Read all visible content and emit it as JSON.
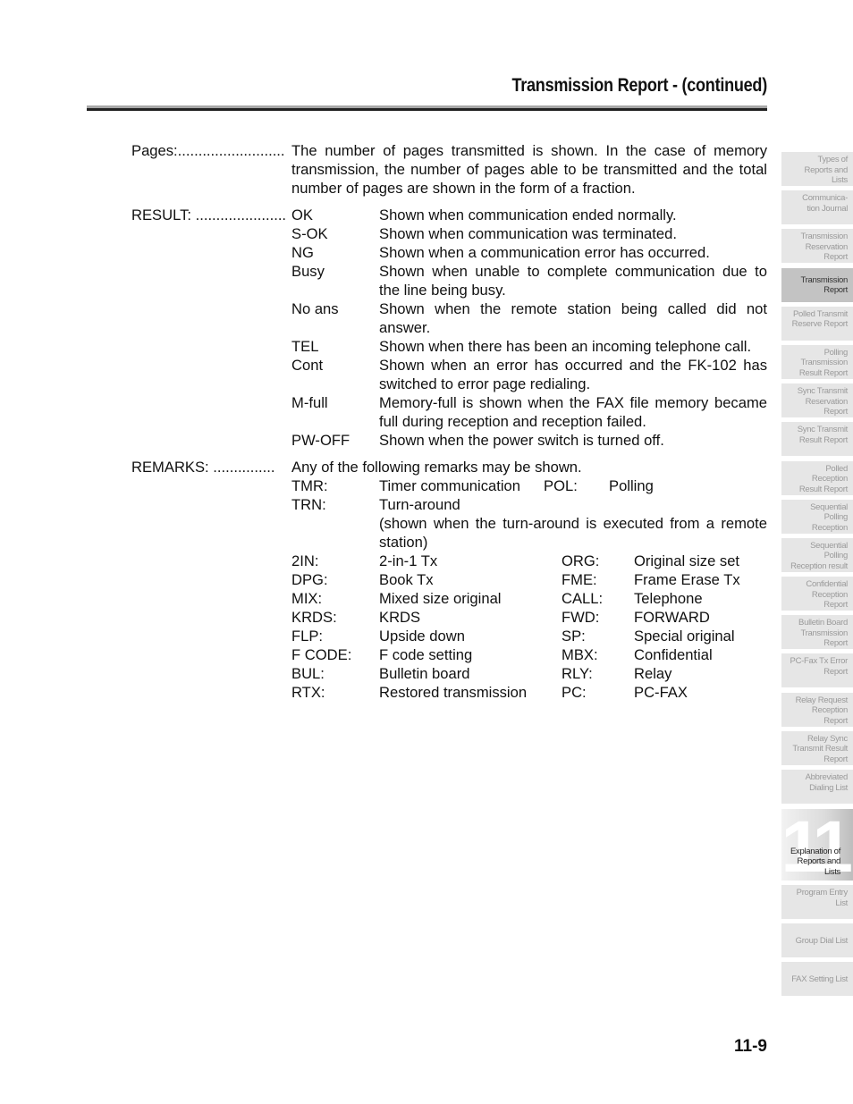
{
  "header": {
    "title": "Transmission Report -  (continued)"
  },
  "pages": {
    "label": "Pages:..........................",
    "text": "The number of pages transmitted is shown. In the case of memory transmission, the number of pages able to be transmitted and the total number of pages are shown in the form of a fraction."
  },
  "result": {
    "label": "RESULT: ......................",
    "items": [
      {
        "code": "OK",
        "desc": "Shown when communication ended normally."
      },
      {
        "code": "S-OK",
        "desc": "Shown when communication was terminated."
      },
      {
        "code": "NG",
        "desc": "Shown when a communication error has occurred."
      },
      {
        "code": "Busy",
        "desc": "Shown when unable to complete communication due to the line being busy."
      },
      {
        "code": "No ans",
        "desc": "Shown when the remote station being called did not answer."
      },
      {
        "code": "TEL",
        "desc": "Shown when there has been an incoming telephone call."
      },
      {
        "code": "Cont",
        "desc": "Shown when an error has occurred and the FK-102 has switched to error page redialing."
      },
      {
        "code": "M-full",
        "desc": "Memory-full is shown when the FAX file memory became full during reception and reception failed."
      },
      {
        "code": "PW-OFF",
        "desc": "Shown when the power switch is turned off."
      }
    ]
  },
  "remarks": {
    "label": "REMARKS:    ...............",
    "intro": "Any of the following remarks may be shown.",
    "tmr": {
      "code": "TMR:",
      "desc": "Timer communication",
      "code2": "POL:",
      "desc2": "Polling"
    },
    "trn": {
      "code": "TRN:",
      "desc": "Turn-around",
      "note": "(shown when the turn-around is executed from a remote station)"
    },
    "pairs": [
      {
        "c1": "2IN:",
        "d1": "2-in-1 Tx",
        "c2": "ORG:",
        "d2": "Original size set"
      },
      {
        "c1": "DPG:",
        "d1": "Book Tx",
        "c2": "FME:",
        "d2": "Frame Erase Tx"
      },
      {
        "c1": "MIX:",
        "d1": "Mixed size original",
        "c2": "CALL:",
        "d2": "Telephone"
      },
      {
        "c1": "KRDS:",
        "d1": "KRDS",
        "c2": "FWD:",
        "d2": "FORWARD"
      },
      {
        "c1": "FLP:",
        "d1": "Upside down",
        "c2": "SP:",
        "d2": "Special original"
      },
      {
        "c1": "F CODE:",
        "d1": "F code setting",
        "c2": "MBX:",
        "d2": "Confidential"
      },
      {
        "c1": "BUL:",
        "d1": "Bulletin board",
        "c2": "RLY:",
        "d2": "Relay"
      },
      {
        "c1": "RTX:",
        "d1": "Restored transmission",
        "c2": "PC:",
        "d2": "PC-FAX"
      }
    ]
  },
  "sidebar": {
    "tabs": [
      {
        "lines": [
          "Types of",
          "Reports and",
          "Lists"
        ]
      },
      {
        "lines": [
          "Communica-",
          "tion Journal"
        ]
      },
      {
        "lines": [
          "Transmission",
          "Reservation",
          "Report"
        ]
      },
      {
        "lines": [
          "Transmission",
          "Report"
        ],
        "active": true
      },
      {
        "lines": [
          "Polled Transmit",
          "Reserve Report"
        ]
      },
      {
        "lines": [
          "Polling",
          "Transmission",
          "Result Report"
        ]
      },
      {
        "lines": [
          "Sync Transmit",
          "Reservation",
          "Report"
        ]
      },
      {
        "lines": [
          "Sync Transmit",
          "Result Report"
        ]
      },
      {
        "lines": [
          "Polled",
          "Reception",
          "Result Report"
        ]
      },
      {
        "lines": [
          "Sequential",
          "Polling",
          "Reception"
        ]
      },
      {
        "lines": [
          "Sequential",
          "Polling",
          "Reception result"
        ]
      },
      {
        "lines": [
          "Confidential",
          "Reception",
          "Report"
        ]
      },
      {
        "lines": [
          "Bulletin Board",
          "Transmission",
          "Report"
        ]
      },
      {
        "lines": [
          "PC-Fax Tx Error",
          "Report"
        ]
      },
      {
        "lines": [
          "Relay Request",
          "Reception",
          "Report"
        ]
      },
      {
        "lines": [
          "Relay Sync",
          "Transmit Result",
          "Report"
        ]
      },
      {
        "lines": [
          "Abbreviated",
          "Dialing List"
        ]
      }
    ],
    "chapter": {
      "number": "11",
      "lines": [
        "Explanation of",
        "Reports and",
        "Lists"
      ]
    },
    "tabs_after": [
      {
        "lines": [
          "Program Entry",
          "List"
        ]
      },
      {
        "lines": [
          "Group Dial List"
        ]
      },
      {
        "lines": [
          "FAX Setting List"
        ]
      }
    ]
  },
  "footer": {
    "page_number": "11-9"
  }
}
